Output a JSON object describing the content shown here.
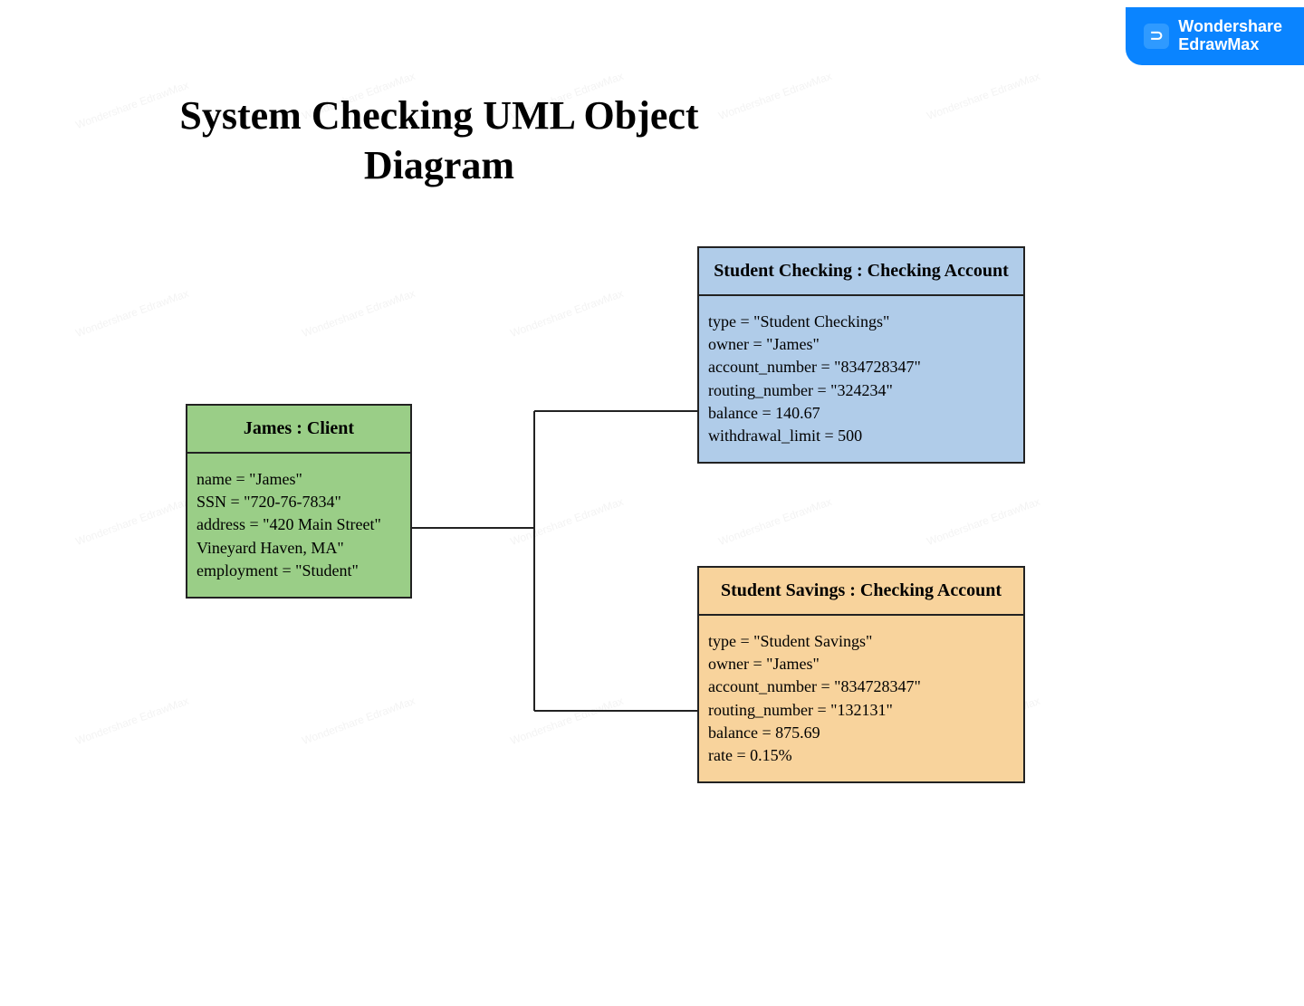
{
  "branding": {
    "name_line1": "Wondershare",
    "name_line2": "EdrawMax",
    "icon_glyph": "⊃"
  },
  "diagram": {
    "title": "System Checking UML Object Diagram",
    "objects": {
      "client": {
        "header": "James : Client",
        "attributes": [
          "name = \"James\"",
          "SSN = \"720-76-7834\"",
          "address = \"420 Main Street\"",
          "Vineyard Haven, MA\"",
          "employment = \"Student\""
        ]
      },
      "checking": {
        "header": "Student Checking : Checking Account",
        "attributes": [
          "type = \"Student Checkings\"",
          "owner = \"James\"",
          "account_number = \"834728347\"",
          "routing_number = \"324234\"",
          "balance = 140.67",
          "withdrawal_limit = 500"
        ]
      },
      "savings": {
        "header": "Student Savings : Checking Account",
        "attributes": [
          "type = \"Student Savings\"",
          "owner = \"James\"",
          "account_number = \"834728347\"",
          "routing_number = \"132131\"",
          "balance = 875.69",
          "rate = 0.15%"
        ]
      }
    }
  },
  "watermark": {
    "text": "Wondershare EdrawMax"
  }
}
